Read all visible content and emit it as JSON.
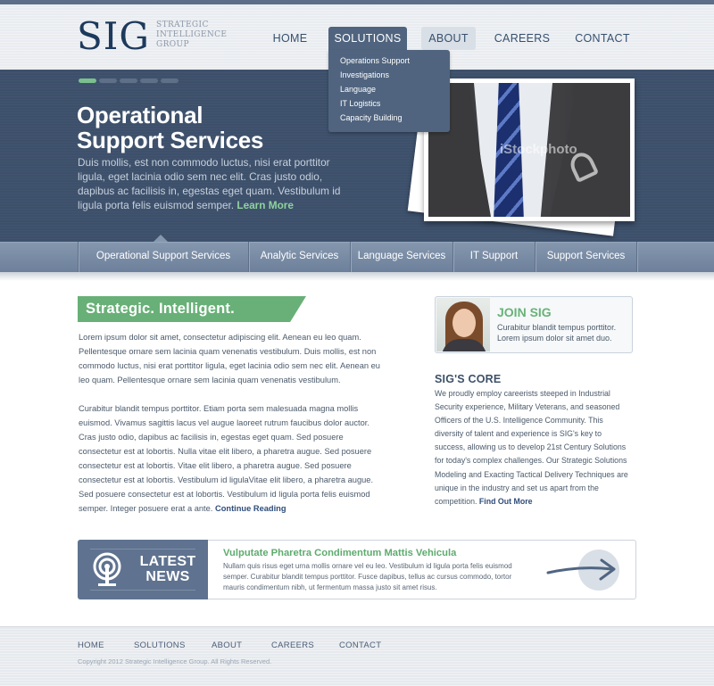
{
  "logo": {
    "mark": "SIG",
    "line1": "STRATEGIC",
    "line2": "INTELLIGENCE",
    "line3": "GROUP"
  },
  "nav": {
    "items": [
      {
        "label": "HOME"
      },
      {
        "label": "SOLUTIONS"
      },
      {
        "label": "ABOUT"
      },
      {
        "label": "CAREERS"
      },
      {
        "label": "CONTACT"
      }
    ],
    "dropdown": [
      "Operations Support",
      "Investigations",
      "Language",
      "IT Logistics",
      "Capacity Building"
    ]
  },
  "hero": {
    "title_line1": "Operational",
    "title_line2": "Support Services",
    "text": "Duis mollis, est non commodo luctus, nisi erat porttitor ligula, eget lacinia odio sem nec elit. Cras justo odio, dapibus ac facilisis in, egestas eget quam. Vestibulum id ligula porta felis euismod semper.",
    "link": "Learn More",
    "watermark": "iStockphoto",
    "slides_total": 5,
    "slide_active": 1
  },
  "services": [
    "Operational Support Services",
    "Analytic Services",
    "Language Services",
    "IT Support",
    "Support Services"
  ],
  "intro": {
    "ribbon": "Strategic. Intelligent.",
    "para1": "Lorem ipsum dolor sit amet, consectetur adipiscing elit. Aenean eu leo quam. Pellentesque ornare sem lacinia quam venenatis vestibulum. Duis mollis, est non commodo luctus, nisi erat porttitor ligula, eget lacinia odio sem nec elit. Aenean eu leo quam. Pellentesque ornare sem lacinia quam venenatis vestibulum.",
    "para2": "Curabitur blandit tempus porttitor. Etiam porta sem malesuada magna mollis euismod. Vivamus sagittis lacus vel augue laoreet rutrum faucibus dolor auctor. Cras justo odio, dapibus ac facilisis in, egestas eget quam. Sed posuere consectetur est at lobortis. Nulla vitae elit libero, a pharetra augue. Sed posuere consectetur est at lobortis. Vitae elit libero, a pharetra augue. Sed posuere consectetur est at lobortis. Vestibulum id ligulaVitae elit libero, a pharetra augue. Sed posuere consectetur est at lobortis. Vestibulum id ligula porta felis euismod semper. Integer posuere erat a ante.",
    "link": "Continue Reading"
  },
  "join": {
    "title": "JOIN SIG",
    "text": "Curabitur blandit tempus porttitor. Lorem ipsum dolor sit amet duo."
  },
  "core": {
    "title": "SIG'S CORE",
    "text": "We proudly employ careerists steeped in Industrial Security experience, Military Veterans, and seasoned Officers of the U.S. Intelligence Community. This diversity of talent and experience is SIG's key to success, allowing us to develop 21st Century Solutions for today's complex challenges. Our Strategic Solutions Modeling and Exacting Tactical Delivery Techniques are unique in the industry and set us apart from the competition.",
    "link": "Find Out More"
  },
  "news": {
    "label_line1": "LATEST",
    "label_line2": "NEWS",
    "title": "Vulputate Pharetra Condimentum Mattis Vehicula",
    "text": "Nullam quis risus eget urna mollis ornare vel eu leo. Vestibulum id ligula porta felis euismod semper. Curabitur blandit tempus porttitor. Fusce dapibus, tellus ac cursus commodo, tortor mauris condimentum nibh, ut fermentum massa justo sit amet risus."
  },
  "footer": {
    "links": [
      "HOME",
      "SOLUTIONS",
      "ABOUT",
      "CAREERS",
      "CONTACT"
    ],
    "copyright": "Copyright 2012 Strategic Intelligence Group. All Rights Reserved."
  },
  "colors": {
    "brand_navy": "#1d3a5c",
    "nav_active": "#50647f",
    "hero_bg": "#3d506b",
    "accent_green": "#68b077",
    "link_blue": "#2f4d7a"
  }
}
